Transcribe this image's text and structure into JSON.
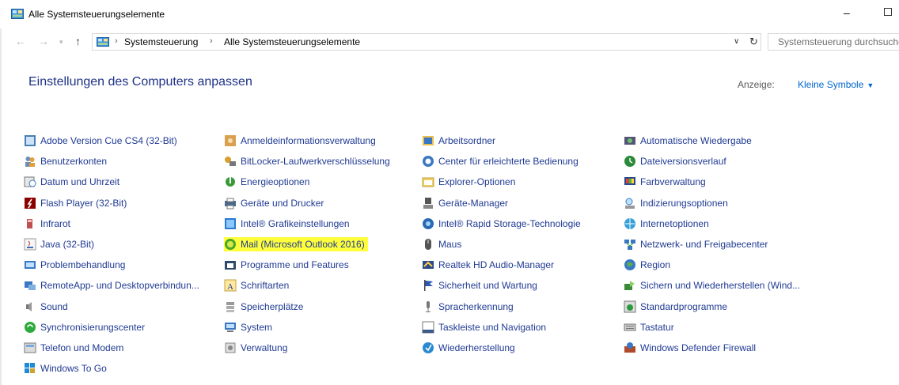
{
  "window": {
    "title": "Alle Systemsteuerungselemente",
    "minimize": "–"
  },
  "address": {
    "crumbs": [
      "Systemsteuerung",
      "Alle Systemsteuerungselemente"
    ],
    "search_placeholder": "Systemsteuerung durchsuchen"
  },
  "header": {
    "title": "Einstellungen des Computers anpassen",
    "view_label": "Anzeige:",
    "view_value": "Kleine Symbole"
  },
  "columns": [
    [
      {
        "label": "Adobe Version Cue CS4 (32-Bit)",
        "icon": "adobe-icon"
      },
      {
        "label": "Benutzerkonten",
        "icon": "users-icon"
      },
      {
        "label": "Datum und Uhrzeit",
        "icon": "clock-icon"
      },
      {
        "label": "Flash Player (32-Bit)",
        "icon": "flash-icon"
      },
      {
        "label": "Infrarot",
        "icon": "infrared-icon"
      },
      {
        "label": "Java (32-Bit)",
        "icon": "java-icon"
      },
      {
        "label": "Problembehandlung",
        "icon": "troubleshoot-icon"
      },
      {
        "label": "RemoteApp- und Desktopverbindun...",
        "icon": "remote-icon"
      },
      {
        "label": "Sound",
        "icon": "speaker-icon"
      },
      {
        "label": "Synchronisierungscenter",
        "icon": "sync-icon"
      },
      {
        "label": "Telefon und Modem",
        "icon": "phone-icon"
      },
      {
        "label": "Windows To Go",
        "icon": "windows-to-go-icon"
      }
    ],
    [
      {
        "label": "Anmeldeinformationsverwaltung",
        "icon": "credential-icon"
      },
      {
        "label": "BitLocker-Laufwerkverschlüsselung",
        "icon": "bitlocker-icon"
      },
      {
        "label": "Energieoptionen",
        "icon": "power-icon"
      },
      {
        "label": "Geräte und Drucker",
        "icon": "printer-icon"
      },
      {
        "label": "Intel® Grafikeinstellungen",
        "icon": "intel-graphics-icon"
      },
      {
        "label": "Mail (Microsoft Outlook 2016)",
        "icon": "mail-icon",
        "highlighted": true
      },
      {
        "label": "Programme und Features",
        "icon": "programs-icon"
      },
      {
        "label": "Schriftarten",
        "icon": "fonts-icon"
      },
      {
        "label": "Speicherplätze",
        "icon": "storage-icon"
      },
      {
        "label": "System",
        "icon": "system-icon"
      },
      {
        "label": "Verwaltung",
        "icon": "admin-icon"
      }
    ],
    [
      {
        "label": "Arbeitsordner",
        "icon": "work-folders-icon"
      },
      {
        "label": "Center für erleichterte Bedienung",
        "icon": "accessibility-icon"
      },
      {
        "label": "Explorer-Optionen",
        "icon": "folder-options-icon"
      },
      {
        "label": "Geräte-Manager",
        "icon": "device-manager-icon"
      },
      {
        "label": "Intel® Rapid Storage-Technologie",
        "icon": "intel-rst-icon"
      },
      {
        "label": "Maus",
        "icon": "mouse-icon"
      },
      {
        "label": "Realtek HD Audio-Manager",
        "icon": "realtek-icon"
      },
      {
        "label": "Sicherheit und Wartung",
        "icon": "flag-icon"
      },
      {
        "label": "Spracherkennung",
        "icon": "microphone-icon"
      },
      {
        "label": "Taskleiste und Navigation",
        "icon": "taskbar-icon"
      },
      {
        "label": "Wiederherstellung",
        "icon": "recovery-icon"
      }
    ],
    [
      {
        "label": "Automatische Wiedergabe",
        "icon": "autoplay-icon"
      },
      {
        "label": "Dateiversionsverlauf",
        "icon": "file-history-icon"
      },
      {
        "label": "Farbverwaltung",
        "icon": "color-management-icon"
      },
      {
        "label": "Indizierungsoptionen",
        "icon": "indexing-icon"
      },
      {
        "label": "Internetoptionen",
        "icon": "internet-options-icon"
      },
      {
        "label": "Netzwerk- und Freigabecenter",
        "icon": "network-icon"
      },
      {
        "label": "Region",
        "icon": "region-icon"
      },
      {
        "label": "Sichern und Wiederherstellen (Wind...",
        "icon": "backup-icon"
      },
      {
        "label": "Standardprogramme",
        "icon": "default-programs-icon"
      },
      {
        "label": "Tastatur",
        "icon": "keyboard-icon"
      },
      {
        "label": "Windows Defender Firewall",
        "icon": "firewall-icon"
      }
    ]
  ],
  "colors": {
    "link": "#1f3a93",
    "heading": "#1e3287",
    "highlight": "#ffff3c",
    "accent": "#0066cc"
  }
}
